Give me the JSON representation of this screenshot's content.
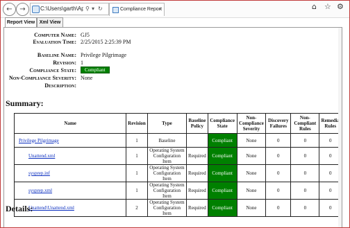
{
  "browser": {
    "address_text": "C:\\Users\\garth\\AppData\\Local\\Temp\\",
    "tab_label": "Compliance Report"
  },
  "view_tabs": [
    "Report View",
    "Xml View"
  ],
  "report": {
    "computer_name_label": "Computer Name:",
    "computer_name": "GJ5",
    "evaluation_time_label": "Evaluation Time:",
    "evaluation_time": "2/25/2015 2:25:39 PM",
    "baseline_name_label": "Baseline Name:",
    "baseline_name": "Privilege Pilgrimage",
    "revision_label": "Revision:",
    "revision": "1",
    "compliance_state_label": "Compliance State:",
    "compliance_state": "Compliant",
    "non_compliance_severity_label": "Non-Compliance Severity:",
    "non_compliance_severity": "None",
    "description_label": "Description:",
    "description": ""
  },
  "summary_heading": "Summary:",
  "details_heading": "Details:",
  "table": {
    "headers": [
      "Name",
      "Revision",
      "Type",
      "Baseline Policy",
      "Compliance State",
      "Non-Compliance Severity",
      "Discovery Failures",
      "Non-Compliant Rules",
      "Remedia Rules"
    ],
    "rows": [
      [
        "Privilege Pilgrimage",
        "1",
        "Baseline",
        "",
        "Compliant",
        "None",
        "0",
        "0",
        "0"
      ],
      [
        "Unattend.xml",
        "1",
        "Operating System Configuration Item",
        "Required",
        "Compliant",
        "None",
        "0",
        "0",
        "0"
      ],
      [
        "sysprep.inf",
        "1",
        "Operating System Configuration Item",
        "Required",
        "Compliant",
        "None",
        "0",
        "0",
        "0"
      ],
      [
        "sysprep.xml",
        "1",
        "Operating System Configuration Item",
        "Required",
        "Compliant",
        "None",
        "0",
        "0",
        "0"
      ],
      [
        "Unattend\\Unattend.xml",
        "2",
        "Operating System Configuration Item",
        "Required",
        "Compliant",
        "None",
        "0",
        "0",
        "0"
      ]
    ]
  },
  "colors": {
    "compliant": "#008000",
    "link": "#0b2fc0",
    "window_border": "#c03a3a"
  }
}
